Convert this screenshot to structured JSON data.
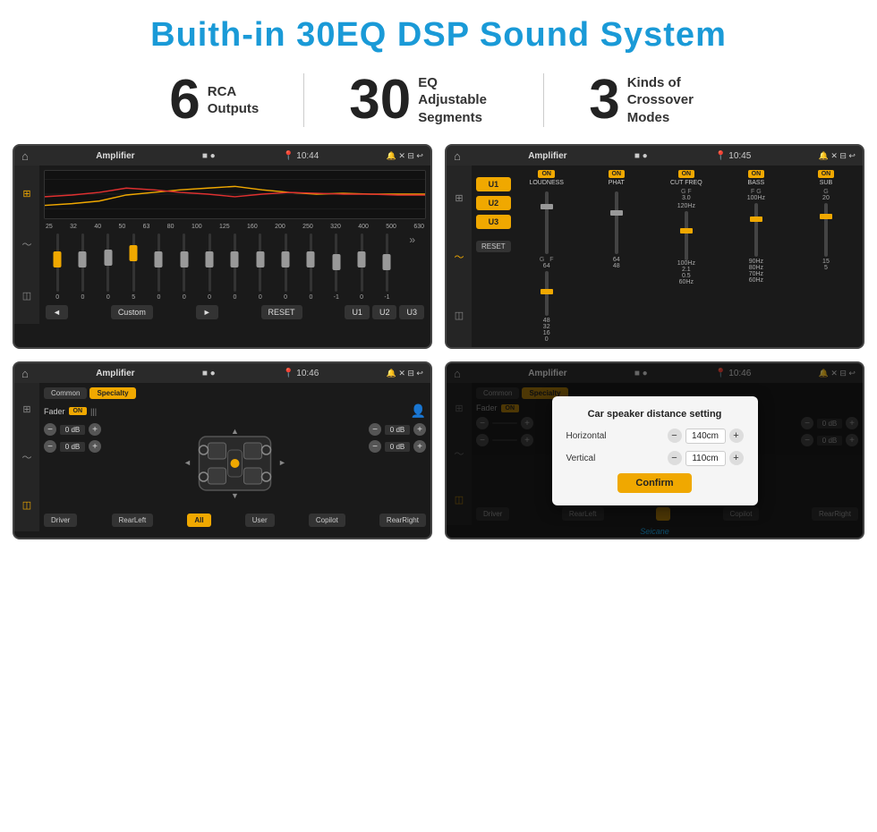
{
  "page": {
    "title": "Buith-in 30EQ DSP Sound System",
    "brand": "Seicane"
  },
  "stats": [
    {
      "number": "6",
      "label": "RCA\nOutputs"
    },
    {
      "number": "30",
      "label": "EQ Adjustable\nSegments"
    },
    {
      "number": "3",
      "label": "Kinds of\nCrossover Modes"
    }
  ],
  "screen1": {
    "title": "Amplifier",
    "time": "10:44",
    "freqs": [
      "25",
      "32",
      "40",
      "50",
      "63",
      "80",
      "100",
      "125",
      "160",
      "200",
      "250",
      "320",
      "400",
      "500",
      "630"
    ],
    "values": [
      "0",
      "0",
      "0",
      "5",
      "0",
      "0",
      "0",
      "0",
      "0",
      "0",
      "0",
      "-1",
      "0",
      "-1"
    ],
    "mode": "Custom",
    "buttons": [
      "RESET",
      "U1",
      "U2",
      "U3"
    ]
  },
  "screen2": {
    "title": "Amplifier",
    "time": "10:45",
    "u_buttons": [
      "U1",
      "U2",
      "U3",
      "RESET"
    ],
    "channels": [
      {
        "name": "LOUDNESS",
        "on": true
      },
      {
        "name": "PHAT",
        "on": true
      },
      {
        "name": "CUT FREQ",
        "on": true,
        "sub": "G  F"
      },
      {
        "name": "BASS",
        "on": true,
        "sub": "F  G"
      },
      {
        "name": "SUB",
        "on": true,
        "sub": "G"
      }
    ]
  },
  "screen3": {
    "title": "Amplifier",
    "time": "10:46",
    "tabs": [
      "Common",
      "Specialty"
    ],
    "fader_label": "Fader",
    "fader_on": "ON",
    "buttons": {
      "driver": "Driver",
      "rear_left": "RearLeft",
      "all": "All",
      "user": "User",
      "copilot": "Copilot",
      "rear_right": "RearRight"
    },
    "volume_rows": [
      {
        "value": "0 dB"
      },
      {
        "value": "0 dB"
      },
      {
        "value": "0 dB"
      },
      {
        "value": "0 dB"
      }
    ]
  },
  "screen4": {
    "title": "Amplifier",
    "time": "10:46",
    "tabs": [
      "Common",
      "Specialty"
    ],
    "dialog": {
      "title": "Car speaker distance setting",
      "horizontal_label": "Horizontal",
      "horizontal_value": "140cm",
      "vertical_label": "Vertical",
      "vertical_value": "110cm",
      "confirm_label": "Confirm"
    },
    "vol_right_top": "0 dB",
    "vol_right_bottom": "0 dB",
    "buttons": {
      "driver": "Driver",
      "rear_left": "RearLeft",
      "copilot": "Copilot",
      "rear_right": "RearRight"
    }
  }
}
